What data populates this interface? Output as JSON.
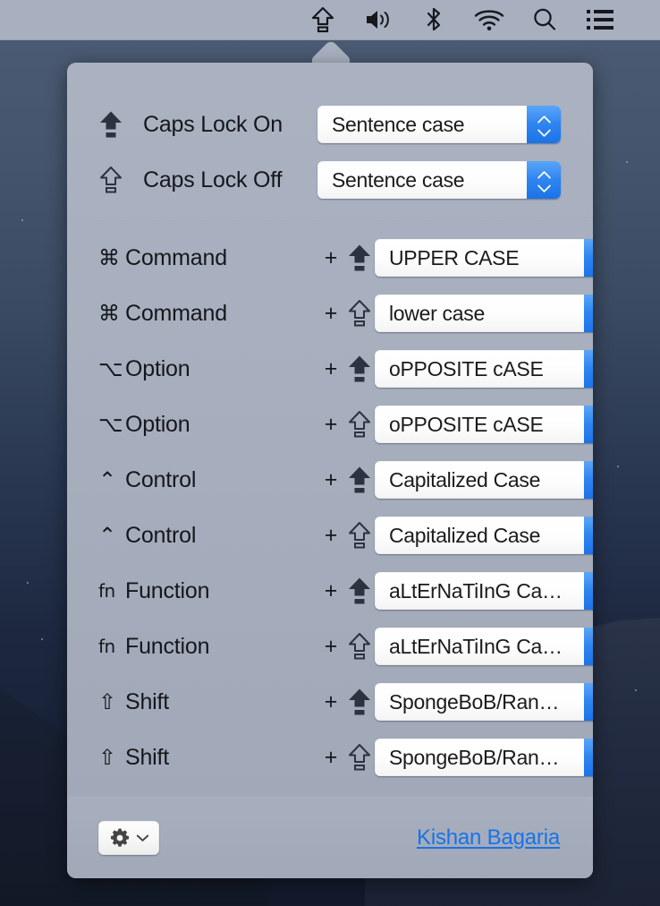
{
  "menubar": {
    "icons": [
      {
        "name": "caps-lock-icon",
        "label": "Caps Lock"
      },
      {
        "name": "volume-icon",
        "label": "Volume"
      },
      {
        "name": "bluetooth-icon",
        "label": "Bluetooth"
      },
      {
        "name": "wifi-icon",
        "label": "Wi-Fi"
      },
      {
        "name": "spotlight-search-icon",
        "label": "Spotlight Search"
      },
      {
        "name": "control-center-icon",
        "label": "Notification Center"
      }
    ]
  },
  "popover": {
    "caps_rows": [
      {
        "icon": "caps-lock-on-icon",
        "icon_state": "filled",
        "label": "Caps Lock On",
        "value": "Sentence case"
      },
      {
        "icon": "caps-lock-off-icon",
        "icon_state": "hollow",
        "label": "Caps Lock Off",
        "value": "Sentence case"
      }
    ],
    "modifier_rows": [
      {
        "symbol": "⌘",
        "modifier": "Command",
        "plus": "+",
        "icon": "caps-lock-on-icon",
        "icon_state": "filled",
        "value": "UPPER CASE"
      },
      {
        "symbol": "⌘",
        "modifier": "Command",
        "plus": "+",
        "icon": "caps-lock-off-icon",
        "icon_state": "hollow",
        "value": "lower case"
      },
      {
        "symbol": "⌥",
        "modifier": "Option",
        "plus": "+",
        "icon": "caps-lock-on-icon",
        "icon_state": "filled",
        "value": "oPPOSITE cASE"
      },
      {
        "symbol": "⌥",
        "modifier": "Option",
        "plus": "+",
        "icon": "caps-lock-off-icon",
        "icon_state": "hollow",
        "value": "oPPOSITE cASE"
      },
      {
        "symbol": "⌃",
        "modifier": "Control",
        "plus": "+",
        "icon": "caps-lock-on-icon",
        "icon_state": "filled",
        "value": "Capitalized Case"
      },
      {
        "symbol": "⌃",
        "modifier": "Control",
        "plus": "+",
        "icon": "caps-lock-off-icon",
        "icon_state": "hollow",
        "value": "Capitalized Case"
      },
      {
        "symbol": "fn",
        "modifier": "Function",
        "plus": "+",
        "icon": "caps-lock-on-icon",
        "icon_state": "filled",
        "value": "aLtErNaTiInG Ca…"
      },
      {
        "symbol": "fn",
        "modifier": "Function",
        "plus": "+",
        "icon": "caps-lock-off-icon",
        "icon_state": "hollow",
        "value": "aLtErNaTiInG Ca…"
      },
      {
        "symbol": "⇧",
        "modifier": "Shift",
        "plus": "+",
        "icon": "caps-lock-on-icon",
        "icon_state": "filled",
        "value": "SpongeBoB/Ran…"
      },
      {
        "symbol": "⇧",
        "modifier": "Shift",
        "plus": "+",
        "icon": "caps-lock-off-icon",
        "icon_state": "hollow",
        "value": "SpongeBoB/Ran…"
      }
    ],
    "footer": {
      "gear_icon": "gear-icon",
      "gear_chevron_icon": "chevron-down-icon",
      "credit_link": "Kishan Bagaria"
    }
  },
  "colors": {
    "accent_blue": "#1b73e8",
    "link_blue": "#1a72e8",
    "popover_bg": "#a7afbe",
    "menubar_bg": "#abb3c2",
    "text": "#15171c"
  }
}
